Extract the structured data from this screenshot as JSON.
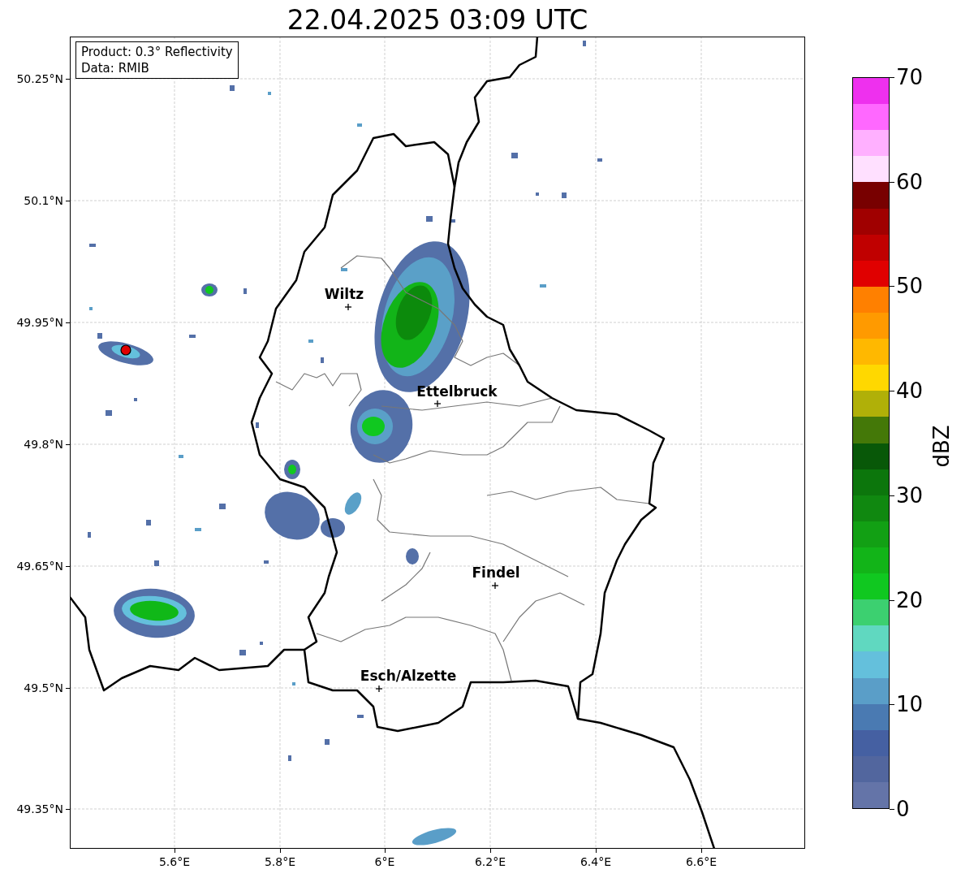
{
  "title": "22.04.2025 03:09 UTC",
  "legend": [
    "Product: 0.3° Reflectivity",
    "Data: RMIB"
  ],
  "cities": [
    "Wiltz",
    "Ettelbruck",
    "Findel",
    "Esch/Alzette"
  ],
  "x_ticks": [
    "5.6°E",
    "5.8°E",
    "6°E",
    "6.2°E",
    "6.4°E",
    "6.6°E"
  ],
  "y_ticks": [
    "50.25°N",
    "50.1°N",
    "49.95°N",
    "49.8°N",
    "49.65°N",
    "49.5°N",
    "49.35°N"
  ],
  "colorbar": {
    "label": "dBZ",
    "ticks": [
      "70",
      "60",
      "50",
      "40",
      "30",
      "20",
      "10",
      "0"
    ],
    "bands": [
      {
        "color": "#ee30ee"
      },
      {
        "color": "#ff68ff"
      },
      {
        "color": "#ffb0ff"
      },
      {
        "color": "#ffe0ff"
      },
      {
        "color": "#780000"
      },
      {
        "color": "#a00000"
      },
      {
        "color": "#c00000"
      },
      {
        "color": "#e00000"
      },
      {
        "color": "#ff8000"
      },
      {
        "color": "#ff9a00"
      },
      {
        "color": "#ffb800"
      },
      {
        "color": "#ffd800"
      },
      {
        "color": "#b0b008"
      },
      {
        "color": "#447808"
      },
      {
        "color": "#085808"
      },
      {
        "color": "#0c760c"
      },
      {
        "color": "#108810"
      },
      {
        "color": "#12a014"
      },
      {
        "color": "#12b418"
      },
      {
        "color": "#10c820"
      },
      {
        "color": "#3cd070"
      },
      {
        "color": "#60d8c0"
      },
      {
        "color": "#64c0dc"
      },
      {
        "color": "#5a9ec8"
      },
      {
        "color": "#4a7ab2"
      },
      {
        "color": "#4560a2"
      },
      {
        "color": "#52669e"
      },
      {
        "color": "#6474a8"
      }
    ]
  }
}
